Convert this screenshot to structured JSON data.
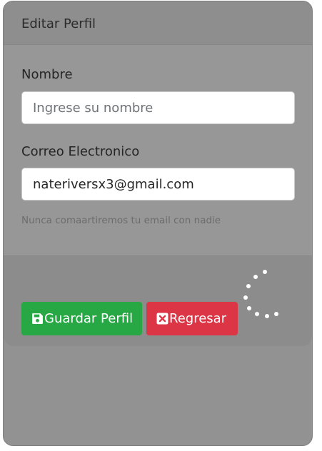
{
  "header": {
    "title": "Editar Perfil"
  },
  "form": {
    "name_label": "Nombre",
    "name_placeholder": "Ingrese su nombre",
    "name_value": "",
    "email_label": "Correo Electronico",
    "email_value": "nateriversx3@gmail.com",
    "email_help": "Nunca comaartiremos tu email con nadie"
  },
  "footer": {
    "save_label": "Guardar Perfil",
    "back_label": "Regresar"
  },
  "icons": {
    "save": "save-icon",
    "back": "close-box-icon",
    "loading": "loading-spinner"
  },
  "colors": {
    "save_button": "#28a745",
    "back_button": "#dc3545",
    "overlay": "#929292"
  }
}
